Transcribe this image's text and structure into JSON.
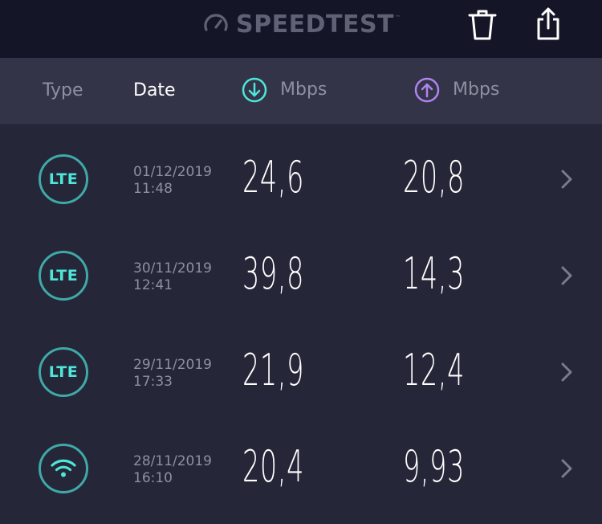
{
  "app": {
    "logo_text": "SPEEDTEST",
    "logo_mark": "™"
  },
  "colors": {
    "accent_teal": "#4ee6d9",
    "accent_purple": "#b083f0",
    "topbar_bg": "#141526",
    "header_bg": "#333447",
    "body_bg": "#252638"
  },
  "toolbar": {
    "delete_icon": "trash-icon",
    "share_icon": "share-icon"
  },
  "header": {
    "type_label": "Type",
    "date_label": "Date",
    "download_label": "Mbps",
    "upload_label": "Mbps",
    "download_icon": "arrow-down-circle-icon",
    "upload_icon": "arrow-up-circle-icon"
  },
  "results": [
    {
      "type": "LTE",
      "type_icon": "lte-icon",
      "date": "01/12/2019",
      "time": "11:48",
      "download": "24,6",
      "upload": "20,8"
    },
    {
      "type": "LTE",
      "type_icon": "lte-icon",
      "date": "30/11/2019",
      "time": "12:41",
      "download": "39,8",
      "upload": "14,3"
    },
    {
      "type": "LTE",
      "type_icon": "lte-icon",
      "date": "29/11/2019",
      "time": "17:33",
      "download": "21,9",
      "upload": "12,4"
    },
    {
      "type": "WiFi",
      "type_icon": "wifi-icon",
      "date": "28/11/2019",
      "time": "16:10",
      "download": "20,4",
      "upload": "9,93"
    }
  ]
}
